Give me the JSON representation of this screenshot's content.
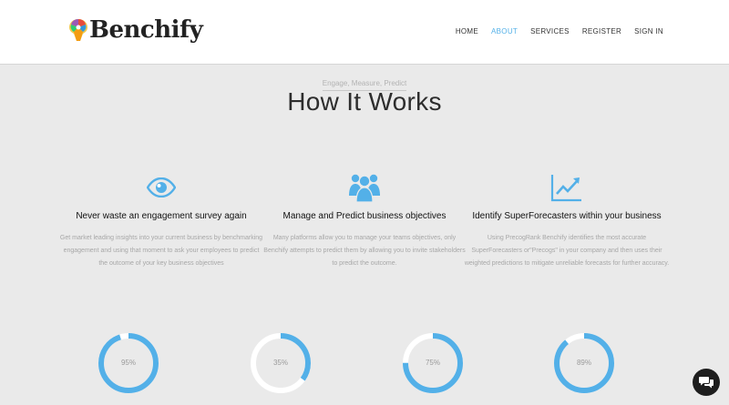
{
  "brand": {
    "name": "Benchify"
  },
  "nav": {
    "items": [
      {
        "label": "HOME",
        "active": false
      },
      {
        "label": "ABOUT",
        "active": true
      },
      {
        "label": "SERVICES",
        "active": false
      },
      {
        "label": "REGISTER",
        "active": false
      },
      {
        "label": "SIGN IN",
        "active": false
      }
    ]
  },
  "hero": {
    "subtitle": "Engage, Measure, Predict",
    "title": "How It Works"
  },
  "features": [
    {
      "icon": "eye-icon",
      "title": "Never waste an engagement survey again",
      "body": "Get market leading insights into your current business by benchmarking engagement and using that moment to ask your employees to predict the outcome of your key business objectives"
    },
    {
      "icon": "group-users-icon",
      "title": "Manage and Predict business objectives",
      "body": "Many platforms allow you to manage your teams objectives, only Benchify attempts to predict them by allowing you to invite stakeholders to predict the outcome."
    },
    {
      "icon": "trend-chart-icon",
      "title": "Identify SuperForecasters within your business",
      "body": "Using PrecogRank Benchify identifies the most accurate SuperForecasters or\"Precogs\" in your company and then uses their weighted predictions to mitigate unreliable forecasts for further accuracy."
    }
  ],
  "gauges": [
    {
      "label": "95%",
      "value": 95
    },
    {
      "label": "35%",
      "value": 35
    },
    {
      "label": "75%",
      "value": 75
    },
    {
      "label": "89%",
      "value": 89
    }
  ],
  "colors": {
    "accent": "#53b0e8",
    "track": "#ffffff",
    "background": "#eaeaea"
  },
  "chat": {
    "icon": "chat-bubbles-icon"
  }
}
